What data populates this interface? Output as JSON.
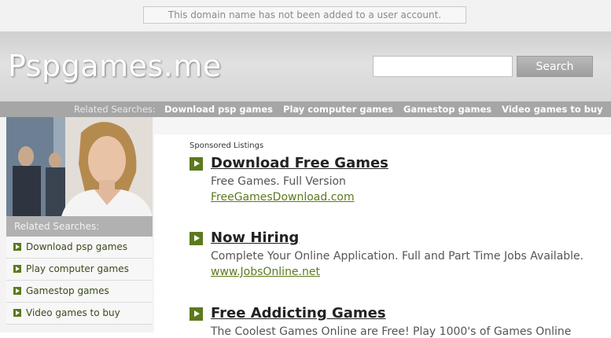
{
  "notice": "This domain name has not been added to a user account.",
  "header": {
    "site_title": "Pspgames.me",
    "search_placeholder": "",
    "search_button": "Search"
  },
  "related_bar": {
    "label": "Related Searches:",
    "links": [
      "Download psp games",
      "Play computer games",
      "Gamestop games",
      "Video games to buy"
    ]
  },
  "sidebar": {
    "related_label": "Related Searches:",
    "items": [
      "Download psp games",
      "Play computer games",
      "Gamestop games",
      "Video games to buy"
    ]
  },
  "main": {
    "sponsored_label": "Sponsored Listings",
    "listings": [
      {
        "title": "Download Free Games",
        "desc": "Free Games. Full Version",
        "url": "FreeGamesDownload.com"
      },
      {
        "title": "Now Hiring",
        "desc": "Complete Your Online Application. Full and Part Time Jobs Available.",
        "url": "www.JobsOnline.net"
      },
      {
        "title": "Free Addicting Games",
        "desc": "The Coolest Games Online are Free! Play 1000's of Games Online",
        "url": ""
      }
    ]
  },
  "colors": {
    "accent_green": "#5b7a1e",
    "related_bar_bg": "#a6a6a6"
  }
}
